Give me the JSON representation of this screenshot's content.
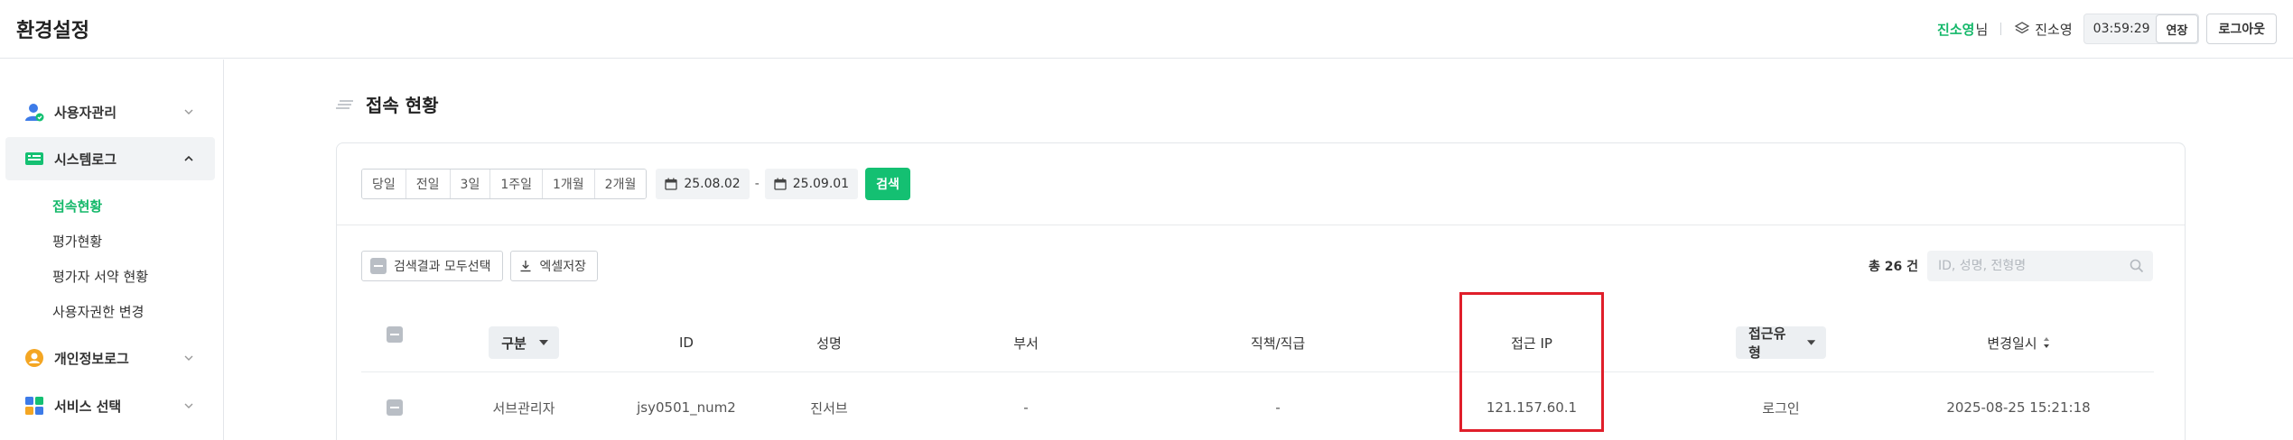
{
  "header": {
    "title": "환경설정",
    "user_name": "진소영",
    "user_suffix": "님",
    "org_name": "진소영",
    "session_timer": "03:59:29",
    "extend_label": "연장",
    "logout_label": "로그아웃"
  },
  "sidebar": {
    "items": [
      {
        "label": "사용자관리",
        "icon": "user-icon",
        "expanded": false
      },
      {
        "label": "시스템로그",
        "icon": "system-log-icon",
        "expanded": true
      },
      {
        "label": "개인정보로그",
        "icon": "privacy-log-icon",
        "expanded": false
      },
      {
        "label": "서비스 선택",
        "icon": "grid-icon",
        "expanded": false
      }
    ],
    "sub_items": [
      {
        "label": "접속현황",
        "active": true
      },
      {
        "label": "평가현황",
        "active": false
      },
      {
        "label": "평가자 서약 현황",
        "active": false
      },
      {
        "label": "사용자권한 변경",
        "active": false
      }
    ]
  },
  "main": {
    "title": "접속 현황",
    "periods": [
      "당일",
      "전일",
      "3일",
      "1주일",
      "1개월",
      "2개월"
    ],
    "date_from": "25.08.02",
    "date_sep": "-",
    "date_to": "25.09.01",
    "search_label": "검색",
    "select_all_label": "검색결과 모두선택",
    "excel_label": "엑셀저장",
    "total_count": "총 26 건",
    "search_placeholder": "ID, 성명, 전형명",
    "columns": {
      "type": "구분",
      "id": "ID",
      "name": "성명",
      "dept": "부서",
      "position": "직책/직급",
      "ip": "접근 IP",
      "access_type": "접근유형",
      "changed_at": "변경일시"
    },
    "rows": [
      {
        "type": "서브관리자",
        "id": "jsy0501_num2",
        "name": "진서브",
        "dept": "-",
        "position": "-",
        "ip": "121.157.60.1",
        "access_type": "로그인",
        "changed_at": "2025-08-25 15:21:18"
      }
    ]
  },
  "colors": {
    "accent": "#14b86a",
    "search_button": "#14c072",
    "highlight": "#e01e2a"
  }
}
